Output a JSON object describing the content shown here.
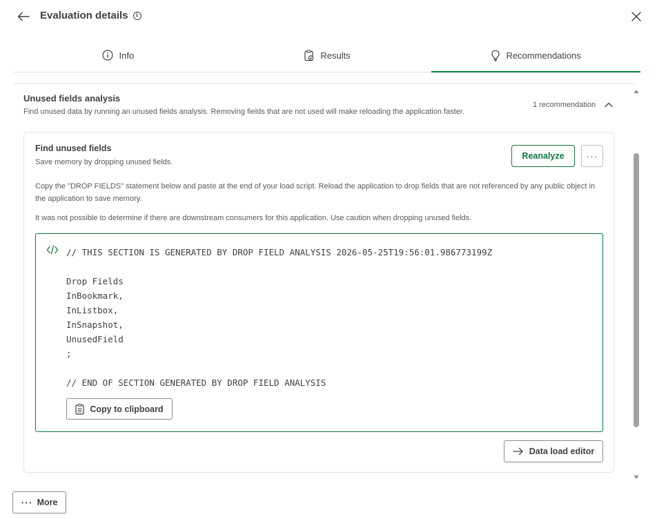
{
  "header": {
    "title": "Evaluation details",
    "info_glyph": "i",
    "back_icon": "arrow-left-icon",
    "close_icon": "close-icon"
  },
  "tabs": [
    {
      "label": "Info",
      "icon": "info-icon",
      "active": false
    },
    {
      "label": "Results",
      "icon": "clipboard-check-icon",
      "active": false
    },
    {
      "label": "Recommendations",
      "icon": "lightbulb-icon",
      "active": true
    }
  ],
  "section": {
    "title": "Unused fields analysis",
    "description": "Find unused data by running an unused fields analysis. Removing fields that are not used will make reloading the application faster.",
    "count_label": "1 recommendation"
  },
  "card": {
    "title": "Find unused fields",
    "subtitle": "Save memory by dropping unused fields.",
    "reanalyze_label": "Reanalyze",
    "more_glyph": "···",
    "paragraph1": "Copy the \"DROP FIELDS\" statement below and paste at the end of your load script. Reload the application to drop fields that are not referenced by any public object in the application to save memory.",
    "paragraph2": "It was not possible to determine if there are downstream consumers for this application. Use caution when dropping unused fields.",
    "code": "// THIS SECTION IS GENERATED BY DROP FIELD ANALYSIS 2026-05-25T19:56:01.986773199Z\n\nDrop Fields\nInBookmark,\nInListbox,\nInSnapshot,\nUnusedField\n;\n\n// END OF SECTION GENERATED BY DROP FIELD ANALYSIS",
    "copy_label": "Copy to clipboard",
    "data_load_editor_label": "Data load editor"
  },
  "footer": {
    "more_label": "More",
    "more_glyph": "···"
  },
  "colors": {
    "accent": "#0b7a3e",
    "text": "#404040",
    "muted": "#595959",
    "border": "#e3e3e3"
  },
  "scroll": {
    "position_fraction": 0.17
  }
}
